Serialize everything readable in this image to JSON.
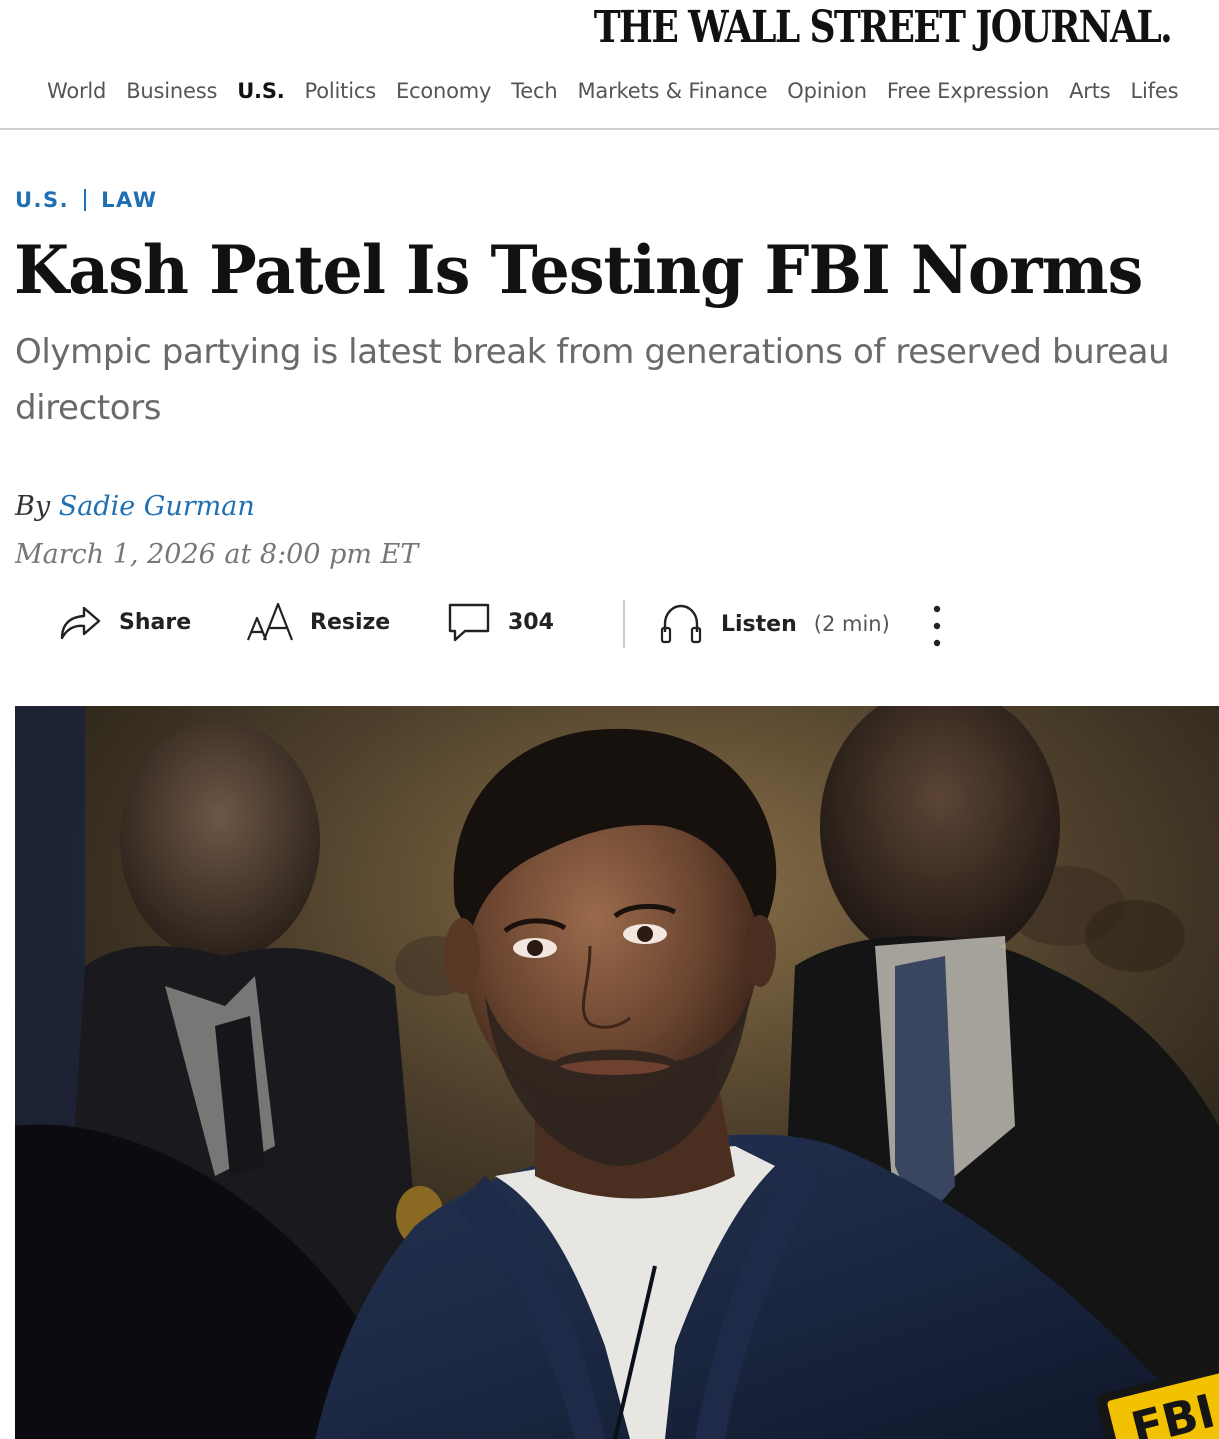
{
  "masthead": {
    "logo_text": "THE WALL STREET JOURNAL."
  },
  "nav": {
    "items": [
      {
        "label": "World",
        "active": false
      },
      {
        "label": "Business",
        "active": false
      },
      {
        "label": "U.S.",
        "active": true
      },
      {
        "label": "Politics",
        "active": false
      },
      {
        "label": "Economy",
        "active": false
      },
      {
        "label": "Tech",
        "active": false
      },
      {
        "label": "Markets & Finance",
        "active": false
      },
      {
        "label": "Opinion",
        "active": false
      },
      {
        "label": "Free Expression",
        "active": false
      },
      {
        "label": "Arts",
        "active": false
      },
      {
        "label": "Lifes",
        "active": false
      }
    ]
  },
  "article": {
    "section": "U.S.",
    "subsection": "LAW",
    "headline": "Kash Patel Is Testing FBI Norms",
    "dek": "Olympic partying is latest break from generations of reserved bureau directors",
    "byline_prefix": "By",
    "author": "Sadie Gurman",
    "timestamp": "March 1, 2026 at 8:00 pm ET"
  },
  "toolbar": {
    "share_label": "Share",
    "resize_label": "Resize",
    "comment_count": "304",
    "listen_label": "Listen",
    "listen_duration": "(2 min)"
  },
  "icons": {
    "share": "share-arrow-icon",
    "resize": "text-resize-icon",
    "comment": "speech-bubble-icon",
    "listen": "headphones-icon",
    "more": "vertical-ellipsis-icon"
  },
  "colors": {
    "accent_blue": "#1f6fb2",
    "text_dark": "#111111",
    "text_gray": "#6a6a6a",
    "rule_gray": "#cfcfcf"
  },
  "hero_image": {
    "patch_text": "FBI"
  }
}
